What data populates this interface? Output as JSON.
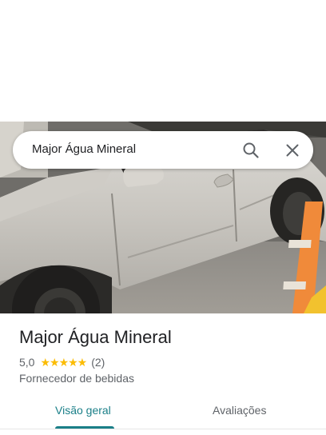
{
  "search": {
    "query": "Major Água Mineral",
    "search_icon": "search-icon",
    "close_icon": "close-icon"
  },
  "place": {
    "name": "Major Água Mineral",
    "rating": "5,0",
    "rating_value": 5.0,
    "stars": "★★★★★",
    "review_count": "(2)",
    "category": "Fornecedor de bebidas"
  },
  "tabs": [
    {
      "label": "Visão geral",
      "selected": true
    },
    {
      "label": "Avaliações",
      "selected": false
    }
  ],
  "colors": {
    "accent": "#1a7f88",
    "star": "#fbbc04",
    "secondary_text": "#5f6368"
  }
}
